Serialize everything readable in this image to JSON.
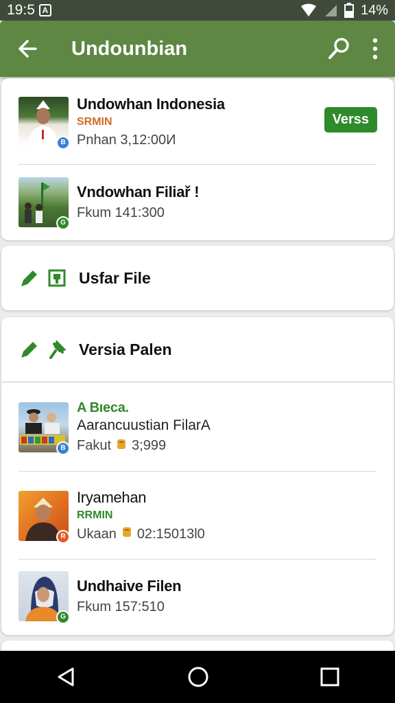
{
  "status_bar": {
    "time": "19:5",
    "battery": "14%"
  },
  "app_bar": {
    "title": "Undounbian"
  },
  "top_card": {
    "items": [
      {
        "name": "Undowhan Indonesia",
        "subtitle": "SRMIN",
        "subtitle_color": "#d06a2a",
        "meta": "Pnhan 3,12:00И",
        "badge": "B",
        "badge_color": "#3a7fd5",
        "action_label": "Verss"
      },
      {
        "name": "Vndowhan Filiař !",
        "meta": "Fkum 141:300",
        "badge": "G",
        "badge_color": "#2f8a2b"
      }
    ]
  },
  "menu": {
    "usfar_file": "Usfar File",
    "versia_palen": "Versia Palen"
  },
  "list": {
    "items": [
      {
        "name": "A Bıeca.",
        "name_color": "#2f8a2b",
        "subtitle": "Aarancuustian FilarA",
        "meta_prefix": "Fakut",
        "meta_value": "3;999",
        "badge": "B",
        "badge_color": "#3a7fd5"
      },
      {
        "name": "Iryamehan",
        "subtitle": "RRMIN",
        "subtitle_color": "#2f8a2b",
        "meta_prefix": "Ukaan",
        "meta_value": "02:15013l0",
        "badge": "R",
        "badge_color": "#e35a2a"
      },
      {
        "name": "Undhaive Filen",
        "meta": "Fkum 157:510",
        "badge": "G",
        "badge_color": "#2f8a2b"
      }
    ]
  },
  "colors": {
    "app_bar": "#5d8743",
    "accent_green": "#2f8a2b",
    "status_bar": "#3f4a3a"
  },
  "icons": [
    "back-arrow-icon",
    "search-icon",
    "more-vert-icon",
    "pencil-icon",
    "file-icon",
    "pin-icon",
    "coin-icon",
    "back-triangle-icon",
    "home-circle-icon",
    "recents-square-icon"
  ]
}
